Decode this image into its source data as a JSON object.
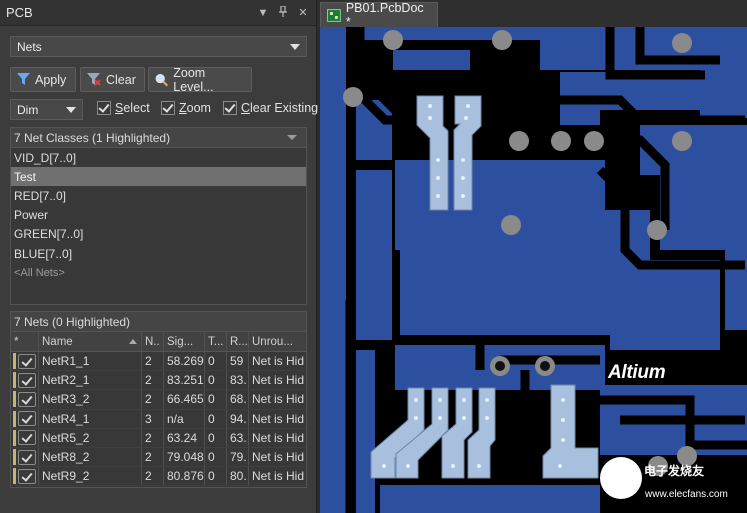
{
  "panel": {
    "title": "PCB",
    "header_buttons": [
      "dropdown-icon",
      "pin-icon",
      "close-icon"
    ],
    "mode_select": "Nets",
    "toolbar": {
      "apply_label": "Apply",
      "clear_label": "Clear",
      "zoom_label": "Zoom Level..."
    },
    "dim_select": "Dim",
    "checkboxes": [
      {
        "label": "Select",
        "checked": true
      },
      {
        "label": "Zoom",
        "checked": true
      },
      {
        "label": "Clear Existing",
        "checked": true
      }
    ],
    "classes": {
      "header": "7 Net Classes (1 Highlighted)",
      "items": [
        "VID_D[7..0]",
        "Test",
        "RED[7..0]",
        "Power",
        "GREEN[7..0]",
        "BLUE[7..0]",
        "<All Nets>"
      ],
      "selected_index": 1
    },
    "nets": {
      "header": "7 Nets (0 Highlighted)",
      "columns": [
        "*",
        "Name",
        "N..",
        "Sig...",
        "T...",
        "R...",
        "Unrou..."
      ],
      "rows": [
        {
          "name": "NetR1_1",
          "n": "2",
          "sig": "58.269",
          "t": "0",
          "r": "59",
          "unrouted": "Net is Hid"
        },
        {
          "name": "NetR2_1",
          "n": "2",
          "sig": "83.251",
          "t": "0",
          "r": "83.",
          "unrouted": "Net is Hid"
        },
        {
          "name": "NetR3_2",
          "n": "2",
          "sig": "66.465",
          "t": "0",
          "r": "68.",
          "unrouted": "Net is Hid"
        },
        {
          "name": "NetR4_1",
          "n": "3",
          "sig": "n/a",
          "t": "0",
          "r": "94.",
          "unrouted": "Net is Hid"
        },
        {
          "name": "NetR5_2",
          "n": "2",
          "sig": "63.24",
          "t": "0",
          "r": "63.",
          "unrouted": "Net is Hid"
        },
        {
          "name": "NetR8_2",
          "n": "2",
          "sig": "79.048",
          "t": "0",
          "r": "79.",
          "unrouted": "Net is Hid"
        },
        {
          "name": "NetR9_2",
          "n": "2",
          "sig": "80.876",
          "t": "0",
          "r": "80.",
          "unrouted": "Net is Hid"
        }
      ]
    }
  },
  "document": {
    "tab_label": "PB01.PcbDoc *"
  },
  "canvas": {
    "logo": "Altium",
    "watermark_text": "电子发烧友",
    "watermark_url": "www.elecfans.com"
  },
  "colors": {
    "copper_blue": "#2d4fa0",
    "highlight_trace": "#a8c0de",
    "pad_grey": "#8a8a8a",
    "panel_bg": "#3c3c3c",
    "selected_row": "#707070",
    "net_swatch": "#c9b27a"
  }
}
